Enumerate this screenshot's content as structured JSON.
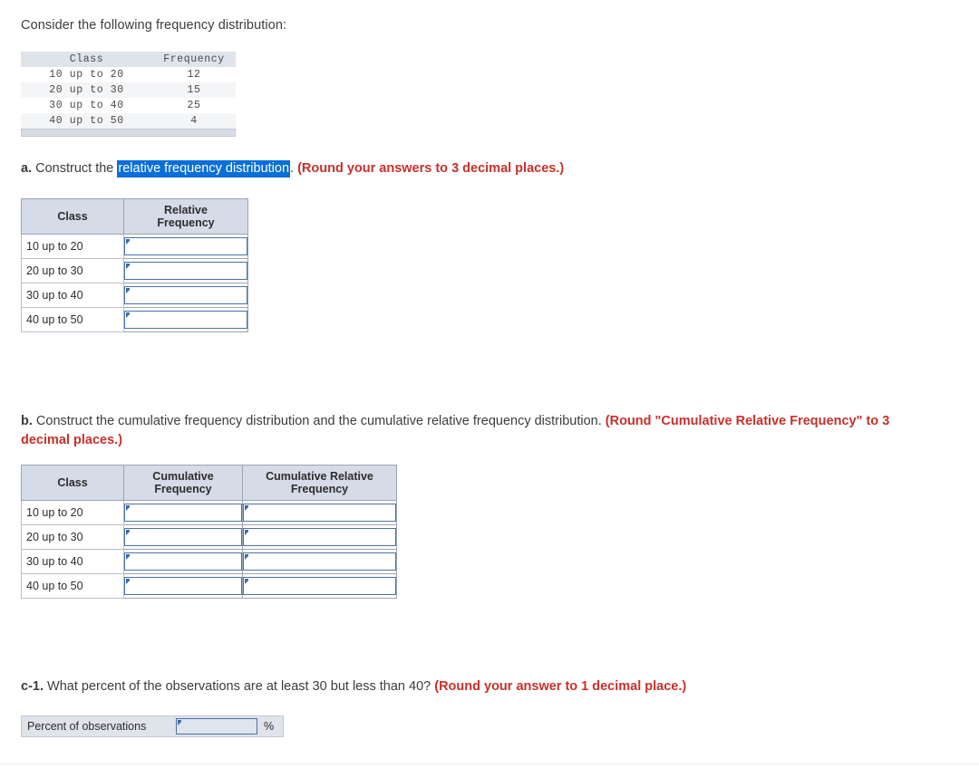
{
  "intro": {
    "text": "Consider the following frequency distribution:"
  },
  "given_table": {
    "headers": [
      "Class",
      "Frequency"
    ],
    "rows": [
      {
        "class": "10 up to 20",
        "frequency": "12"
      },
      {
        "class": "20 up to 30",
        "frequency": "15"
      },
      {
        "class": "30 up to 40",
        "frequency": "25"
      },
      {
        "class": "40 up to 50",
        "frequency": "4"
      }
    ]
  },
  "part_a": {
    "label": "a.",
    "text_before": "Construct the",
    "highlighted": "relative frequency distribution",
    "text_after": ".",
    "instruction": "(Round your answers to 3 decimal places.)",
    "table": {
      "headers": [
        "Class",
        "Relative Frequency"
      ],
      "header_class": "Class",
      "header_relative_line1": "Relative",
      "header_relative_line2": "Frequency",
      "rows": [
        {
          "class": "10 up to 20",
          "relative_frequency": ""
        },
        {
          "class": "20 up to 30",
          "relative_frequency": ""
        },
        {
          "class": "30 up to 40",
          "relative_frequency": ""
        },
        {
          "class": "40 up to 50",
          "relative_frequency": ""
        }
      ]
    }
  },
  "part_b": {
    "label": "b.",
    "text": "Construct the cumulative frequency distribution and the cumulative relative frequency distribution.",
    "instruction": "(Round \"Cumulative Relative Frequency\" to 3 decimal places.)",
    "table": {
      "header_class": "Class",
      "header_cf_line1": "Cumulative",
      "header_cf_line2": "Frequency",
      "header_crf_line1": "Cumulative Relative",
      "header_crf_line2": "Frequency",
      "rows": [
        {
          "class": "10 up to 20",
          "cumulative_frequency": "",
          "cumulative_relative_frequency": ""
        },
        {
          "class": "20 up to 30",
          "cumulative_frequency": "",
          "cumulative_relative_frequency": ""
        },
        {
          "class": "30 up to 40",
          "cumulative_frequency": "",
          "cumulative_relative_frequency": ""
        },
        {
          "class": "40 up to 50",
          "cumulative_frequency": "",
          "cumulative_relative_frequency": ""
        }
      ]
    }
  },
  "part_c1": {
    "label": "c-1.",
    "text": "What percent of the observations are at least 30 but less than 40?",
    "instruction": "(Round your answer to 1 decimal place.)",
    "answer_row": {
      "label": "Percent of observations",
      "value": "",
      "suffix": "%"
    }
  },
  "colors": {
    "instruction_red": "#c8302a",
    "selection_blue": "#0a6fd8",
    "header_fill": "#d5dbe7",
    "input_border": "#4a72a8",
    "page_background": "#ffffff"
  }
}
